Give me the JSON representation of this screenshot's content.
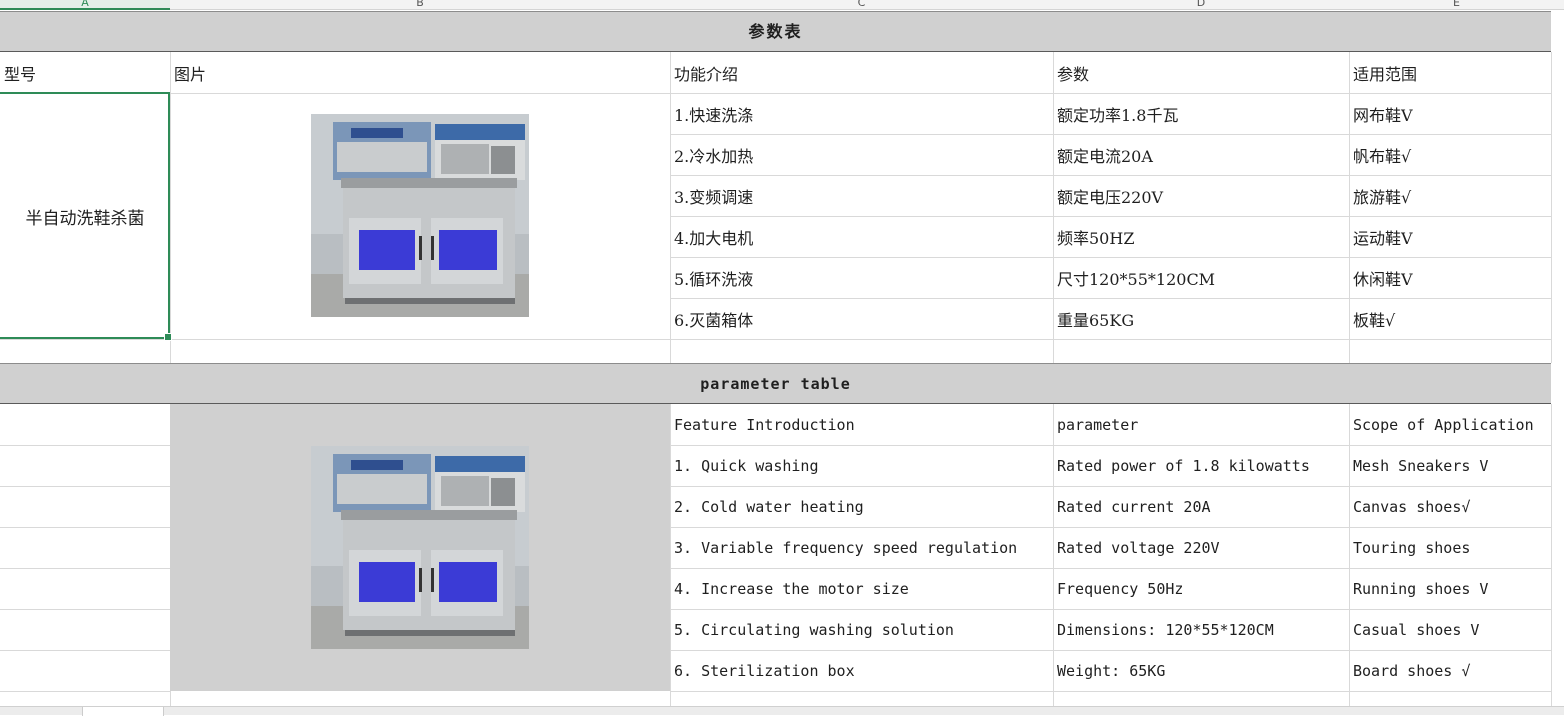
{
  "columns": [
    "A",
    "B",
    "C",
    "D",
    "E"
  ],
  "cn_table": {
    "title": "参数表",
    "headers": [
      "型号",
      "图片",
      "功能介绍",
      "参数",
      "适用范围"
    ],
    "model": "半自动洗鞋杀菌",
    "rows": [
      [
        "1.快速洗涤",
        "额定功率1.8千瓦",
        "网布鞋V"
      ],
      [
        "2.冷水加热",
        "额定电流20A",
        "帆布鞋√"
      ],
      [
        "3.变频调速",
        "额定电压220V",
        "旅游鞋√"
      ],
      [
        "4.加大电机",
        "频率50HZ",
        "运动鞋V"
      ],
      [
        "5.循环洗液",
        "尺寸120*55*120CM",
        "休闲鞋V"
      ],
      [
        "6.灭菌箱体",
        "重量65KG",
        "板鞋√"
      ]
    ]
  },
  "en_table": {
    "title": "parameter table",
    "headers": [
      "Feature Introduction",
      "parameter",
      "Scope of Application"
    ],
    "rows": [
      [
        "1. Quick washing",
        "Rated power of 1.8 kilowatts",
        "Mesh Sneakers V"
      ],
      [
        "2. Cold water heating",
        "Rated current 20A",
        "Canvas shoes√"
      ],
      [
        "3. Variable frequency speed regulation",
        "Rated voltage 220V",
        "Touring shoes"
      ],
      [
        "4. Increase the motor size",
        "Frequency 50Hz",
        "Running shoes V"
      ],
      [
        "5. Circulating washing solution",
        "Dimensions: 120*55*120CM",
        "Casual shoes V"
      ],
      [
        "6. Sterilization box",
        "Weight: 65KG",
        "Board shoes √"
      ]
    ]
  },
  "colors": {
    "band": "#d0d0d0",
    "grid": "#d9d9d9",
    "selection": "#2e8b57",
    "machine_glow": "#3b3bd6"
  }
}
